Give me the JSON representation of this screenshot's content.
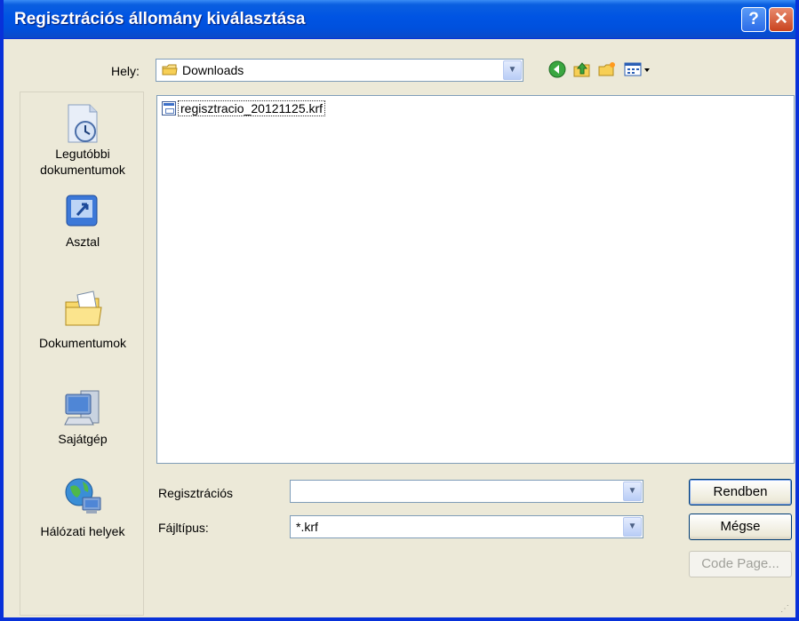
{
  "window": {
    "title": "Regisztrációs állomány kiválasztása",
    "help_glyph": "?",
    "close_glyph": "✕"
  },
  "location": {
    "label": "Hely:",
    "value": "Downloads"
  },
  "toolbar": {
    "icons": [
      "back-icon",
      "up-folder-icon",
      "new-folder-icon",
      "view-menu-icon"
    ]
  },
  "places": [
    {
      "label": "Legutóbbi dokumentumok",
      "icon": "recent-documents-icon"
    },
    {
      "label": "Asztal",
      "icon": "desktop-icon"
    },
    {
      "label": "Dokumentumok",
      "icon": "my-documents-icon"
    },
    {
      "label": "Sajátgép",
      "icon": "my-computer-icon"
    },
    {
      "label": "Hálózati helyek",
      "icon": "network-places-icon"
    }
  ],
  "files": [
    {
      "name": "regisztracio_20121125.krf",
      "icon": "krf-file-icon"
    }
  ],
  "filename": {
    "label": "Regisztrációs",
    "value": ""
  },
  "filetype": {
    "label": "Fájltípus:",
    "value": "*.krf"
  },
  "buttons": {
    "ok": "Rendben",
    "cancel": "Mégse",
    "code_page": "Code Page..."
  },
  "colors": {
    "titlebar": "#0054e3",
    "frame": "#0831d9",
    "dialog_bg": "#ece9d8"
  }
}
